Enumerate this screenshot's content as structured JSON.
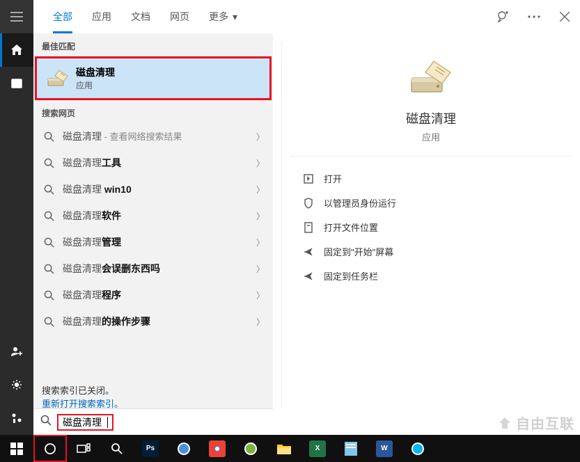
{
  "top_bar": {
    "tabs": [
      "全部",
      "应用",
      "文档",
      "网页",
      "更多"
    ],
    "active_tab_index": 0
  },
  "left_rail": {
    "items": [
      "home",
      "recent",
      "add-user",
      "settings",
      "share"
    ],
    "active_index": 0
  },
  "results": {
    "best_match_header": "最佳匹配",
    "best_match": {
      "title": "磁盘清理",
      "subtitle": "应用"
    },
    "web_header": "搜索网页",
    "web_items": [
      {
        "base": "磁盘清理",
        "bold": "",
        "suffix": " - 查看网络搜索结果"
      },
      {
        "base": "磁盘清理",
        "bold": "工具",
        "suffix": ""
      },
      {
        "base": "磁盘清理",
        "bold": " win10",
        "suffix": ""
      },
      {
        "base": "磁盘清理",
        "bold": "软件",
        "suffix": ""
      },
      {
        "base": "磁盘清理",
        "bold": "管理",
        "suffix": ""
      },
      {
        "base": "磁盘清理",
        "bold": "会误删东西吗",
        "suffix": ""
      },
      {
        "base": "磁盘清理",
        "bold": "程序",
        "suffix": ""
      },
      {
        "base": "磁盘清理",
        "bold": "的操作步骤",
        "suffix": ""
      }
    ],
    "index_notice_line1": "搜索索引已关闭。",
    "index_notice_line2": "重新打开搜索索引。"
  },
  "search_box": {
    "value": "磁盘清理"
  },
  "detail": {
    "title": "磁盘清理",
    "subtitle": "应用",
    "actions": [
      "打开",
      "以管理员身份运行",
      "打开文件位置",
      "固定到\"开始\"屏幕",
      "固定到任务栏"
    ]
  },
  "taskbar": {
    "system_items": [
      "start",
      "search",
      "task-view",
      "magnifier"
    ],
    "apps": [
      {
        "name": "photoshop",
        "bg": "#001e36",
        "label": "Ps"
      },
      {
        "name": "browser1",
        "bg": "#4a90e2",
        "label": ""
      },
      {
        "name": "chrome",
        "bg": "#ea4335",
        "label": ""
      },
      {
        "name": "browser2",
        "bg": "#7cb342",
        "label": ""
      },
      {
        "name": "explorer",
        "bg": "#ffca28",
        "label": ""
      },
      {
        "name": "excel",
        "bg": "#217346",
        "label": "X"
      },
      {
        "name": "notepad",
        "bg": "#81c7e8",
        "label": ""
      },
      {
        "name": "word",
        "bg": "#2b579a",
        "label": "W"
      },
      {
        "name": "qq-browser",
        "bg": "#00b7f0",
        "label": ""
      }
    ]
  },
  "watermark_text": "自由互联"
}
